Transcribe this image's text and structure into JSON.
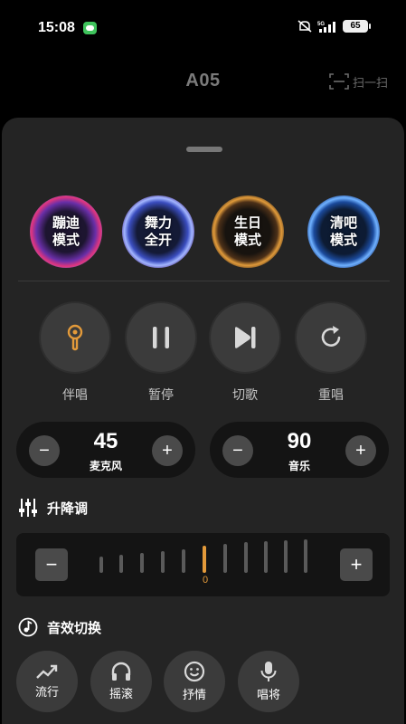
{
  "status_bar": {
    "time": "15:08",
    "battery": "65",
    "icons": [
      "wechat-icon",
      "mute-icon",
      "5g-signal-icon",
      "battery-icon"
    ]
  },
  "header": {
    "title": "A05",
    "scan_label": "扫一扫"
  },
  "modes": [
    {
      "label": "蹦迪\n模式"
    },
    {
      "label": "舞力\n全开"
    },
    {
      "label": "生日\n模式"
    },
    {
      "label": "清吧\n模式"
    }
  ],
  "controls": [
    {
      "label": "伴唱",
      "icon": "microphone-icon"
    },
    {
      "label": "暂停",
      "icon": "pause-icon"
    },
    {
      "label": "切歌",
      "icon": "skip-next-icon"
    },
    {
      "label": "重唱",
      "icon": "replay-icon"
    }
  ],
  "volumes": {
    "mic": {
      "value": "45",
      "label": "麦克风"
    },
    "music": {
      "value": "90",
      "label": "音乐"
    },
    "minus": "−",
    "plus": "+"
  },
  "pitch": {
    "title": "升降调",
    "value": "0",
    "minus": "−",
    "plus": "+"
  },
  "sound_effects": {
    "title": "音效切换",
    "items": [
      {
        "label": "流行",
        "icon": "trend-up-icon"
      },
      {
        "label": "摇滚",
        "icon": "headphones-icon"
      },
      {
        "label": "抒情",
        "icon": "smile-icon"
      },
      {
        "label": "唱将",
        "icon": "microphone-icon"
      }
    ]
  },
  "colors": {
    "accent": "#e39a3a",
    "sheet": "#242424",
    "button": "#3b3b3b"
  }
}
